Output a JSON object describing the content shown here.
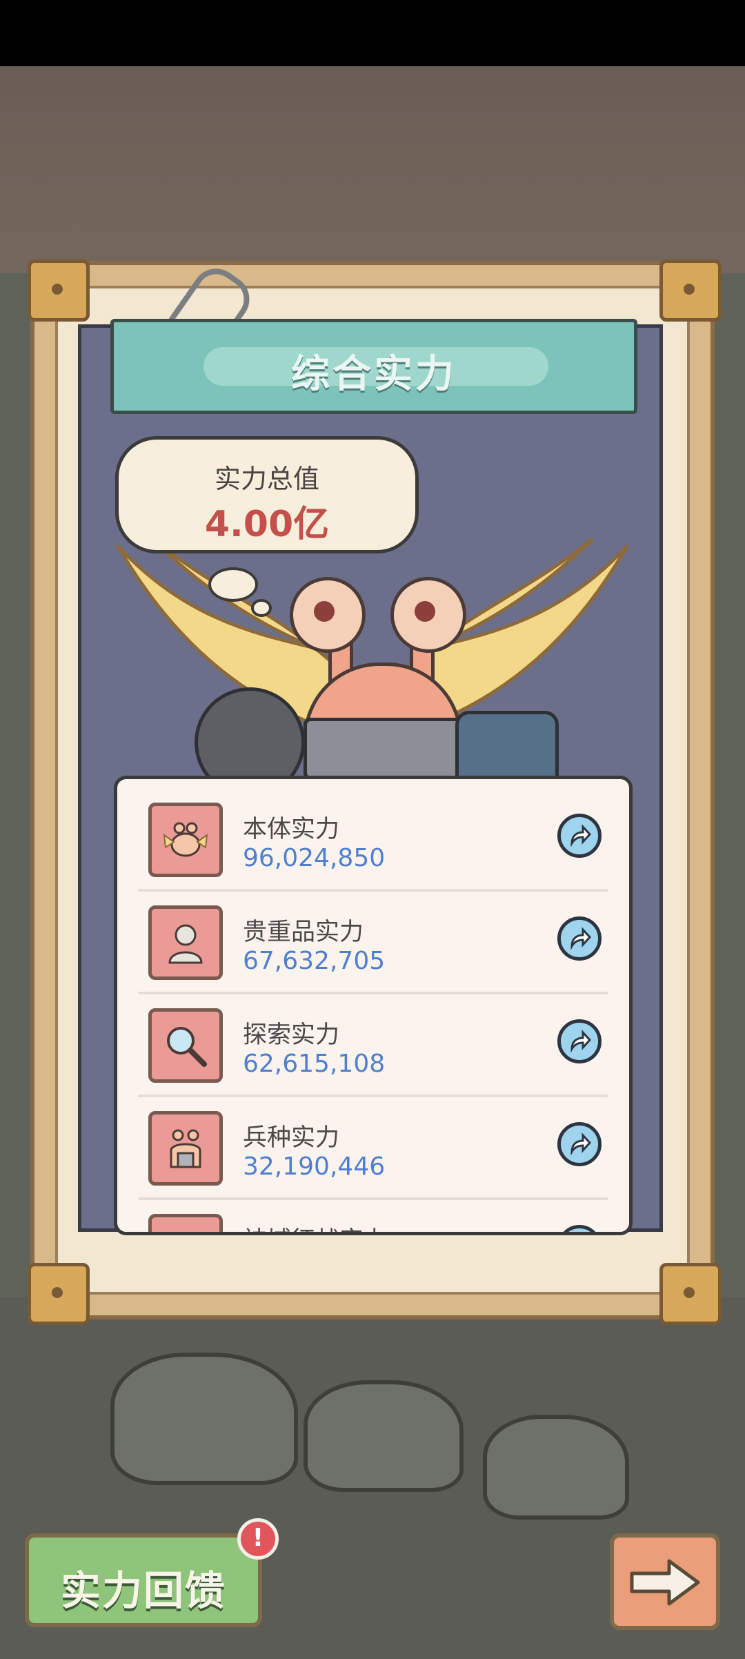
{
  "panel": {
    "title": "综合实力",
    "total_label": "实力总值",
    "total_value": "4.00亿"
  },
  "stats": [
    {
      "title": "本体实力",
      "value": "96,024,850",
      "icon": "winged-snail-icon"
    },
    {
      "title": "贵重品实力",
      "value": "67,632,705",
      "icon": "bust-statue-icon"
    },
    {
      "title": "探索实力",
      "value": "62,615,108",
      "icon": "magnifier-icon"
    },
    {
      "title": "兵种实力",
      "value": "32,190,446",
      "icon": "soldier-snail-icon"
    },
    {
      "title": "神域征战实力",
      "value": "",
      "icon": "partial-icon"
    }
  ],
  "bottom": {
    "feedback_label": "实力回馈",
    "alert_mark": "!"
  },
  "colors": {
    "banner": "#7cc3ba",
    "value_text": "#4f7fcf",
    "total_value": "#c4504c",
    "feedback_button": "#8fc57b",
    "next_button": "#eb9e7a"
  }
}
